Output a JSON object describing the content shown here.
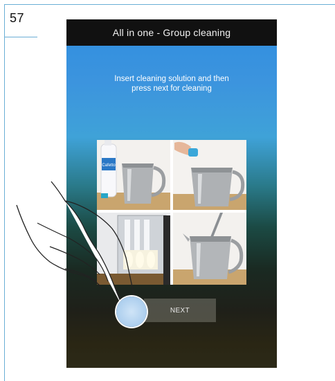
{
  "page_number": "57",
  "screen": {
    "title": "All in one - Group cleaning",
    "instruction_line1": "Insert cleaning solution and then",
    "instruction_line2": "press next for cleaning",
    "next_label": "NEXT"
  },
  "photos": [
    {
      "name": "cleaning-bottle-and-pitcher-photo",
      "bottle_label": "Cafetto"
    },
    {
      "name": "tablet-into-pitcher-photo"
    },
    {
      "name": "machine-milk-bottles-photo"
    },
    {
      "name": "pitcher-with-spout-photo"
    }
  ],
  "colors": {
    "rule": "#6aaed6",
    "header_bg": "#111111",
    "gradient_top": "#2f8ee0",
    "gradient_bottom": "#2c2a18",
    "tap_indicator": "#aecfee"
  },
  "icons": {
    "hand": "pointing-hand-icon",
    "tap": "tap-indicator-icon"
  }
}
